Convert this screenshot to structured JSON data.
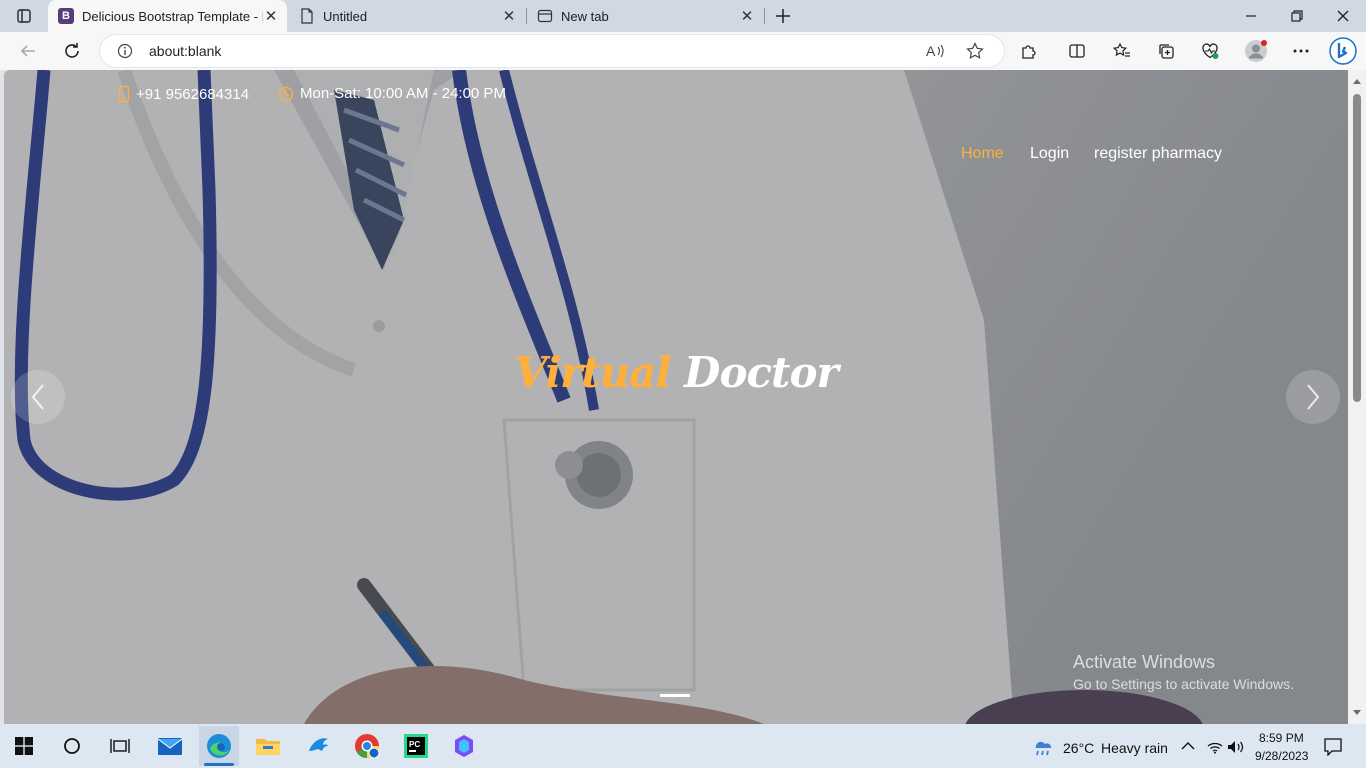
{
  "browser": {
    "tabs": [
      {
        "title": "Delicious Bootstrap Template - In",
        "icon": "bootstrap-logo-icon",
        "favicon_text": "B",
        "active": true
      },
      {
        "title": "Untitled",
        "icon": "page-icon",
        "active": false
      },
      {
        "title": "New tab",
        "icon": "new-tab-page-icon",
        "active": false
      }
    ],
    "address": "about:blank",
    "accent_color": "#0f6cbd"
  },
  "page": {
    "topbar": {
      "phone": "+91 9562684314",
      "hours": "Mon-Sat: 10:00 AM - 24:00 PM"
    },
    "nav": [
      {
        "label": "Home",
        "active": true
      },
      {
        "label": "Login",
        "active": false
      },
      {
        "label": "register pharmacy",
        "active": false
      }
    ],
    "hero": {
      "brand_accent": "Virtual",
      "brand_rest": "Doctor"
    },
    "accent_color": "#ffb03b",
    "watermark": {
      "line1": "Activate Windows",
      "line2": "Go to Settings to activate Windows."
    }
  },
  "taskbar": {
    "apps": [
      "windows-start-icon",
      "search-icon",
      "task-view-icon",
      "mail-icon",
      "edge-icon",
      "file-explorer-icon",
      "dolphin-app-icon",
      "chrome-icon",
      "pycharm-icon",
      "copilot-icon"
    ],
    "weather": {
      "temp": "26°C",
      "condition": "Heavy rain"
    },
    "time": "8:59 PM",
    "date": "9/28/2023"
  }
}
